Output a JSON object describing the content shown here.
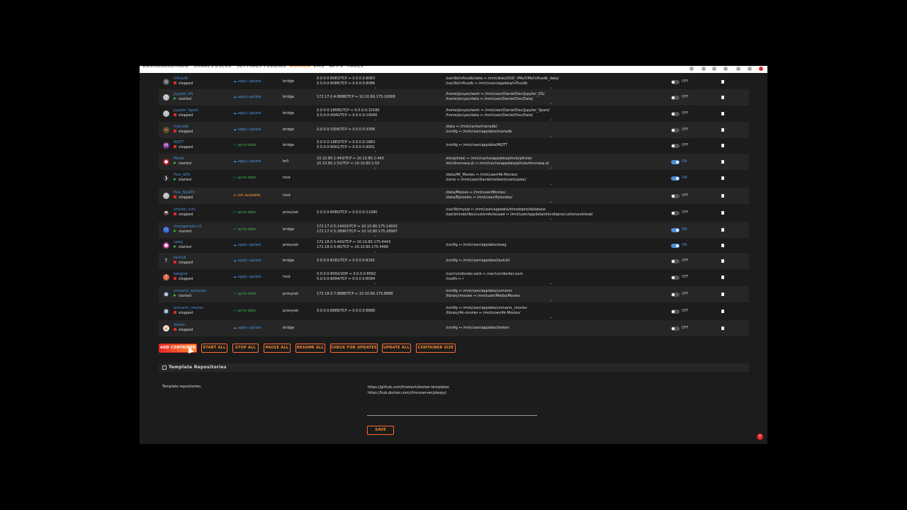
{
  "nav": {
    "items": [
      "DASHBOARD",
      "MAIN",
      "SHARES",
      "USERS",
      "SETTINGS",
      "PLUGINS",
      "DOCKER",
      "VMS",
      "APPS",
      "TOOLS"
    ],
    "active": "DOCKER"
  },
  "containers": [
    {
      "name": "influxdb",
      "state": "stopped",
      "update": "apply update",
      "update_status": "apply",
      "network": "bridge",
      "ports": [
        "0.0.0.0:8083/TCP ↔ 0.0.0.0:8083",
        "0.0.0.0:8086/TCP ↔ 0.0.0.0:8086"
      ],
      "volumes": [
        "/var/lib/influxdb/data ↔ /mnt/disks/SSD_VMs/VMs/influxdb_data/",
        "/var/lib/influxdb ↔ /mnt/user/appdata/influxdb"
      ],
      "autostart": "OFF",
      "avatar_color": "#555555",
      "avatar_glyph": "◎"
    },
    {
      "name": "Jupyter_DS",
      "state": "started",
      "update": "apply update",
      "update_status": "apply",
      "network": "bridge",
      "ports": [
        "172.17.0.4:8888/TCP ↔ 10.10.80.175:10088"
      ],
      "volumes": [
        "/home/jovyan/work ↔ /mnt/user/Daniel/Dev/Jupyter_DS/",
        "/home/jovyan/data ↔ /mnt/user/Daniel/Dev/Data/"
      ],
      "autostart": "OFF",
      "avatar_color": "#bbbbbb",
      "avatar_glyph": "?"
    },
    {
      "name": "Jupyter_Spark",
      "state": "stopped",
      "update": "apply update",
      "update_status": "apply",
      "network": "bridge",
      "ports": [
        "0.0.0.0:18080/TCP ↔ 0.0.0.0:10180",
        "0.0.0.0:4040/TCP ↔ 0.0.0.0:10040"
      ],
      "volumes": [
        "/home/jovyan/work ↔ /mnt/user/Daniel/Dev/Jupyter_Spark/",
        "/home/jovyan/data ↔ /mnt/user/Daniel/Dev/Data/"
      ],
      "autostart": "OFF",
      "avatar_color": "#bbbbbb",
      "avatar_glyph": "?"
    },
    {
      "name": "mariadb",
      "state": "stopped",
      "update": "apply update",
      "update_status": "apply",
      "network": "bridge",
      "ports": [
        "0.0.0.0:3306/TCP ↔ 0.0.0.0:3306"
      ],
      "volumes": [
        "/data ↔ /mnt/cache/mariadb/",
        "/config ↔ /mnt/user/appdata/mariadb"
      ],
      "autostart": "OFF",
      "avatar_color": "#6b4a2a",
      "avatar_glyph": "⌁"
    },
    {
      "name": "MQTT",
      "state": "stopped",
      "update": "up-to-date",
      "update_status": "ok",
      "network": "bridge",
      "ports": [
        "0.0.0.0:1883/TCP ↔ 0.0.0.0:1883",
        "0.0.0.0:9001/TCP ↔ 0.0.0.0:9001"
      ],
      "volumes": [
        "/config ↔ /mnt/user/appdata/MQTT"
      ],
      "autostart": "OFF",
      "avatar_color": "#7a2f9a",
      "avatar_glyph": "M"
    },
    {
      "name": "Pihole",
      "state": "started",
      "update": "apply update",
      "update_status": "apply",
      "network": "br0",
      "ports": [
        "10.10.80.1:443/TCP ↔ 10.10.80.1:443",
        "10.10.80.1:53/TCP ↔ 10.10.80.1:53"
      ],
      "volumes": [
        "/etc/pihole/ ↔ /mnt/cache/appdata/pihole/pihole/",
        "/etc/dnsmasq.d/ ↔ /mnt/cache/appdata/pihole/dnsmasq.d/"
      ],
      "autostart": "ON",
      "avatar_color": "#c0212a",
      "avatar_glyph": "●"
    },
    {
      "name": "Plex_GPU",
      "state": "started",
      "update": "up-to-date",
      "update_status": "ok",
      "network": "host",
      "ports": [],
      "volumes": [
        "/data/4K_Movies ↔ /mnt/user/4k-Movies/",
        "/certs ↔ /mnt/user/Daniel/network/certs/plex/"
      ],
      "autostart": "ON",
      "avatar_color": "#2a2a2a",
      "avatar_glyph": "❯"
    },
    {
      "name": "Plex_NoGPU",
      "state": "stopped",
      "update": "not available",
      "update_status": "na",
      "network": "host",
      "ports": [],
      "volumes": [
        "/data/Movies ↔ /mnt/user/Movies/",
        "/data/Episodes ↔ /mnt/user/Episodes/"
      ],
      "autostart": "OFF",
      "avatar_color": "#bbbbbb",
      "avatar_glyph": "?"
    },
    {
      "name": "shinobi_cctv",
      "state": "stopped",
      "update": "up-to-date",
      "update_status": "ok",
      "network": "proxynet",
      "ports": [
        "0.0.0.0:8080/TCP ↔ 0.0.0.0:11080"
      ],
      "volumes": [
        "/var/lib/mysql ↔ /mnt/user/appdata/shinobipro/database",
        "/opt/shinobi/libs/customAutoLoad ↔ /mnt/user/appdata/shinobipro/customautoload"
      ],
      "autostart": "OFF",
      "avatar_color": "#3a2a20",
      "avatar_glyph": "◓"
    },
    {
      "name": "storagenode-v3",
      "state": "started",
      "update": "up-to-date",
      "update_status": "ok",
      "network": "bridge",
      "ports": [
        "172.17.0.5:14002/TCP ↔ 10.10.80.175:14002",
        "172.17.0.5:28967/TCP ↔ 10.10.80.175:28967"
      ],
      "volumes": [],
      "autostart": "ON",
      "avatar_color": "#2a5fd0",
      "avatar_glyph": "⬡"
    },
    {
      "name": "swag",
      "state": "started",
      "update": "apply update",
      "update_status": "apply",
      "network": "proxynet",
      "ports": [
        "172.18.0.5:443/TCP ↔ 10.10.80.175:4443",
        "172.18.0.5:80/TCP ↔ 10.10.80.175:4480"
      ],
      "volumes": [
        "/config ↔ /mnt/user/appdata/swag"
      ],
      "autostart": "ON",
      "avatar_color": "#c03aa0",
      "avatar_glyph": "●"
    },
    {
      "name": "tautulli",
      "state": "stopped",
      "update": "apply update",
      "update_status": "apply",
      "network": "bridge",
      "ports": [
        "0.0.0.0:8181/TCP ↔ 0.0.0.0:8181"
      ],
      "volumes": [
        "/config ↔ /mnt/user/appdata/tautulli"
      ],
      "autostart": "OFF",
      "avatar_color": "#2a2a2a",
      "avatar_glyph": "T"
    },
    {
      "name": "telegraf",
      "state": "stopped",
      "update": "apply update",
      "update_status": "apply",
      "network": "host",
      "ports": [
        "0.0.0.0:8092/UDP ↔ 0.0.0.0:8092",
        "0.0.0.0:8094/TCP ↔ 0.0.0.0:8094"
      ],
      "volumes": [
        "/var/run/docker.sock ↔ /var/run/docker.sock",
        "/rootfs ↔ /"
      ],
      "autostart": "OFF",
      "avatar_color": "#e0604a",
      "avatar_glyph": "T"
    },
    {
      "name": "unmanic_episodes",
      "state": "started",
      "update": "up-to-date",
      "update_status": "ok",
      "network": "proxynet",
      "ports": [
        "172.18.0.7:8888/TCP ↔ 10.10.80.175:8888"
      ],
      "volumes": [
        "/config ↔ /mnt/user/appdata/unmanic",
        "/library/movies ↔ /mnt/user/Media/Movies"
      ],
      "autostart": "OFF",
      "avatar_color": "#2a3a5a",
      "avatar_glyph": "▦"
    },
    {
      "name": "unmanic_movies",
      "state": "stopped",
      "update": "up-to-date",
      "update_status": "ok",
      "network": "proxynet",
      "ports": [
        "0.0.0.0:8888/TCP ↔ 0.0.0.0:8888"
      ],
      "volumes": [
        "/config ↔ /mnt/user/appdata/unmanic_movies",
        "/library/4k-movies ↔ /mnt/user/4k-Movies/"
      ],
      "autostart": "OFF",
      "avatar_color": "#2a3a5a",
      "avatar_glyph": "▦"
    },
    {
      "name": "Varken",
      "state": "stopped",
      "update": "apply update",
      "update_status": "apply",
      "network": "bridge",
      "ports": [],
      "volumes": [
        "/config ↔ /mnt/user/appdata/Varken"
      ],
      "autostart": "OFF",
      "avatar_color": "#e8e8e8",
      "avatar_glyph": "🐷"
    }
  ],
  "actions": {
    "add_container": "ADD CONTAINER",
    "start_all": "START ALL",
    "stop_all": "STOP ALL",
    "pause_all": "PAUSE ALL",
    "resume_all": "RESUME ALL",
    "check_updates": "CHECK FOR UPDATES",
    "update_all": "UPDATE ALL",
    "container_size": "CONTAINER SIZE"
  },
  "templates": {
    "section_title": "Template Repositories",
    "label": "Template repositories:",
    "repos": [
      "https://github.com/limetech/docker-templates",
      "https://hub.docker.com/r/linuxserver/plexpy/"
    ],
    "save_label": "SAVE"
  },
  "colors": {
    "accent": "#ff8c2f",
    "stopped": "#e22828",
    "started": "#3bb34a",
    "link": "#4a8fd9",
    "panel": "#1c1c1c"
  },
  "icons": {
    "update_apply": "cloud-icon",
    "update_ok": "check-icon",
    "update_na": "warning-icon",
    "delete": "trash-icon",
    "scroll_top": "arrow-up-icon"
  }
}
